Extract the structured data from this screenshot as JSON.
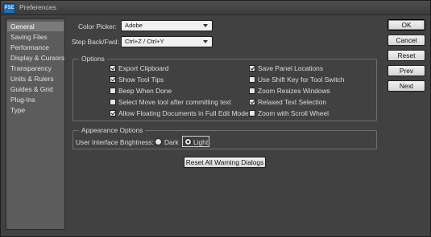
{
  "window": {
    "title": "Preferences",
    "app_icon_label": "PSE"
  },
  "sidebar": {
    "items": [
      {
        "label": "General",
        "selected": true
      },
      {
        "label": "Saving Files",
        "selected": false
      },
      {
        "label": "Performance",
        "selected": false
      },
      {
        "label": "Display & Cursors",
        "selected": false
      },
      {
        "label": "Transparency",
        "selected": false
      },
      {
        "label": "Units & Rulers",
        "selected": false
      },
      {
        "label": "Guides & Grid",
        "selected": false
      },
      {
        "label": "Plug-Ins",
        "selected": false
      },
      {
        "label": "Type",
        "selected": false
      }
    ]
  },
  "fields": {
    "color_picker": {
      "label": "Color Picker:",
      "value": "Adobe"
    },
    "step_back": {
      "label": "Step Back/Fwd:",
      "value": "Ctrl+Z / Ctrl+Y"
    }
  },
  "options": {
    "title": "Options",
    "left": [
      {
        "label": "Export Clipboard",
        "checked": true
      },
      {
        "label": "Show Tool Tips",
        "checked": true
      },
      {
        "label": "Beep When Done",
        "checked": false
      },
      {
        "label": "Select Move tool after committing text",
        "checked": false
      },
      {
        "label": "Allow Floating Documents in Full Edit Mode",
        "checked": true
      }
    ],
    "right": [
      {
        "label": "Save Panel Locations",
        "checked": true
      },
      {
        "label": "Use Shift Key for Tool Switch",
        "checked": false
      },
      {
        "label": "Zoom Resizes Windows",
        "checked": false
      },
      {
        "label": "Relaxed Text Selection",
        "checked": true
      },
      {
        "label": "Zoom with Scroll Wheel",
        "checked": false
      }
    ]
  },
  "appearance": {
    "title": "Appearance Options",
    "brightness_label": "User Interface Brightness:",
    "options": [
      {
        "label": "Dark",
        "selected": false
      },
      {
        "label": "Light",
        "selected": true
      }
    ]
  },
  "reset_warnings_label": "Reset All Warning Dialogs",
  "buttons": {
    "ok": "OK",
    "cancel": "Cancel",
    "reset": "Reset",
    "prev": "Prev",
    "next": "Next"
  },
  "colors": {
    "window_bg": "#414141",
    "sidebar_bg": "#5c5c5c",
    "selected_bg": "#7a7a7a"
  }
}
